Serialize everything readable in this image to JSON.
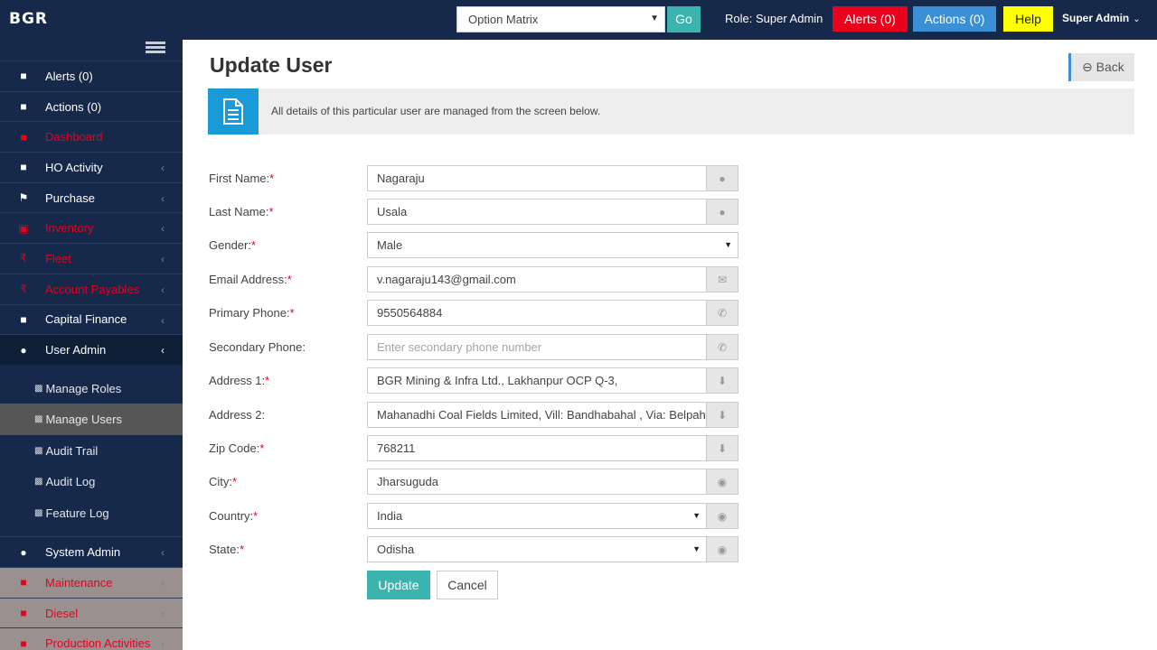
{
  "header": {
    "logo_text": "BGR",
    "matrix_select": "Option Matrix",
    "go_label": "Go",
    "role_text": "Role: Super Admin",
    "alerts_label": "Alerts (0)",
    "actions_label": "Actions (0)",
    "help_label": "Help",
    "user_name": "Super Admin"
  },
  "sidebar": {
    "items": [
      {
        "label": "Alerts (0)",
        "icon": "chart-icon"
      },
      {
        "label": "Actions (0)",
        "icon": "chart-icon"
      },
      {
        "label": "Dashboard",
        "icon": "chart-icon"
      },
      {
        "label": "HO Activity",
        "icon": "chart-icon"
      },
      {
        "label": "Purchase",
        "icon": "flag-icon"
      },
      {
        "label": "Inventory",
        "icon": "building-icon"
      },
      {
        "label": "Fleet",
        "icon": "rupee-icon"
      },
      {
        "label": "Account Payables",
        "icon": "rupee-icon"
      },
      {
        "label": "Capital Finance",
        "icon": "chart-icon"
      },
      {
        "label": "User Admin",
        "icon": "users-icon"
      }
    ],
    "sub_items": [
      {
        "label": "Manage Roles"
      },
      {
        "label": "Manage Users"
      },
      {
        "label": "Audit Trail"
      },
      {
        "label": "Audit Log"
      },
      {
        "label": "Feature Log"
      }
    ],
    "items_after": [
      {
        "label": "System Admin",
        "icon": "users-icon"
      },
      {
        "label": "Maintenance",
        "icon": "chart-icon"
      },
      {
        "label": "Diesel",
        "icon": "chart-icon"
      },
      {
        "label": "Production Activities",
        "icon": "chart-icon"
      }
    ]
  },
  "main": {
    "title": "Update User",
    "back_label": "Back",
    "info_text": "All details of this particular user are managed from the screen below.",
    "form": {
      "first_name": {
        "label": "First Name:",
        "value": "Nagaraju"
      },
      "last_name": {
        "label": "Last Name:",
        "value": "Usala"
      },
      "gender": {
        "label": "Gender:",
        "value": "Male"
      },
      "email": {
        "label": "Email Address:",
        "value": "v.nagaraju143@gmail.com"
      },
      "primary_phone": {
        "label": "Primary Phone:",
        "value": "9550564884"
      },
      "secondary_phone": {
        "label": "Secondary Phone:",
        "placeholder": "Enter secondary phone number"
      },
      "address1": {
        "label": "Address 1:",
        "value": "BGR Mining & Infra Ltd., Lakhanpur OCP Q-3,"
      },
      "address2": {
        "label": "Address 2:",
        "value": "Mahanadhi Coal Fields Limited, Vill: Bandhabahal , Via: Belpahar"
      },
      "zip": {
        "label": "Zip Code:",
        "value": "768211"
      },
      "city": {
        "label": "City:",
        "value": "Jharsuguda"
      },
      "country": {
        "label": "Country:",
        "value": "India"
      },
      "state": {
        "label": "State:",
        "value": "Odisha"
      }
    },
    "update_label": "Update",
    "cancel_label": "Cancel"
  },
  "colors": {
    "topbar": "#16294a",
    "accent_teal": "#3bb4b0",
    "alerts_red": "#e8001c",
    "actions_blue": "#3b8fd4",
    "help_yellow": "#ffff00",
    "info_blue": "#1a9ad7"
  }
}
